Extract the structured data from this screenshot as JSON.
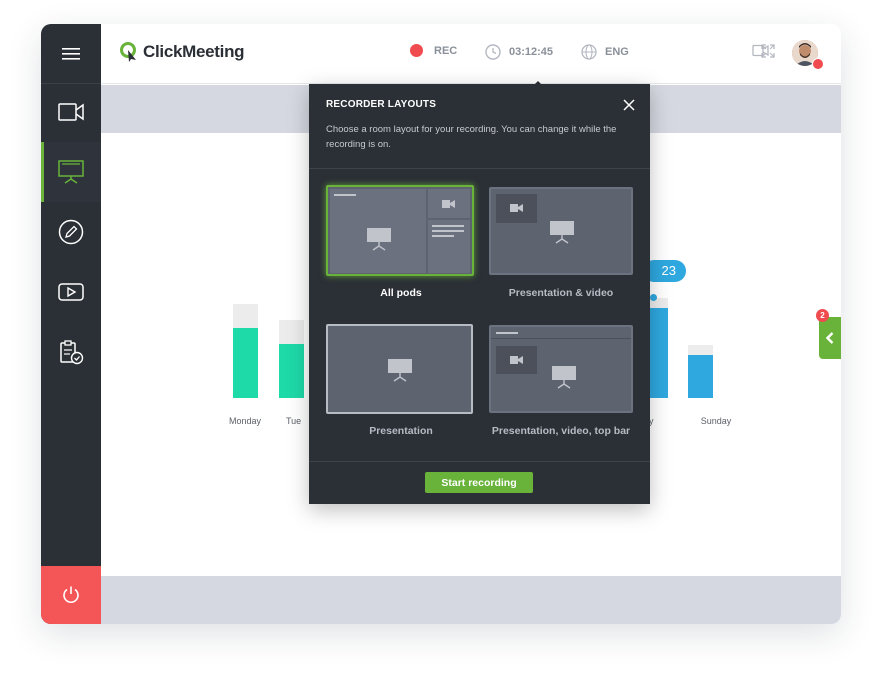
{
  "brand": {
    "name": "ClickMeeting",
    "accent": "#69b33a"
  },
  "sidebar": {
    "menu_icon": "hamburger-menu-icon",
    "items": [
      {
        "icon": "video-camera-icon"
      },
      {
        "icon": "presentation-board-icon",
        "active": true
      },
      {
        "icon": "pencil-edit-icon"
      },
      {
        "icon": "play-video-icon"
      },
      {
        "icon": "clipboard-check-icon"
      }
    ],
    "power_icon": "power-icon",
    "power_color": "#f45657"
  },
  "topbar": {
    "rec_label": "REC",
    "timer": "03:12:45",
    "language": "ENG",
    "rec_color": "#f04c50"
  },
  "chart_data": {
    "type": "bar",
    "categories": [
      "Monday",
      "Tue",
      "Sunday"
    ],
    "visible_category_fragments": [
      "y"
    ],
    "series_colors": [
      "#1ed9a8",
      "#2fa8df"
    ],
    "tooltip_value": "23"
  },
  "side_panel": {
    "badge_count": "2",
    "toggle_icon": "chevron-left-icon"
  },
  "modal": {
    "title": "RECORDER LAYOUTS",
    "description": "Choose a room layout for your recording. You can change it while the recording is on.",
    "layouts": [
      {
        "label": "All pods",
        "selected": true
      },
      {
        "label": "Presentation & video"
      },
      {
        "label": "Presentation"
      },
      {
        "label": "Presentation, video, top bar"
      }
    ],
    "start_button": "Start recording"
  }
}
